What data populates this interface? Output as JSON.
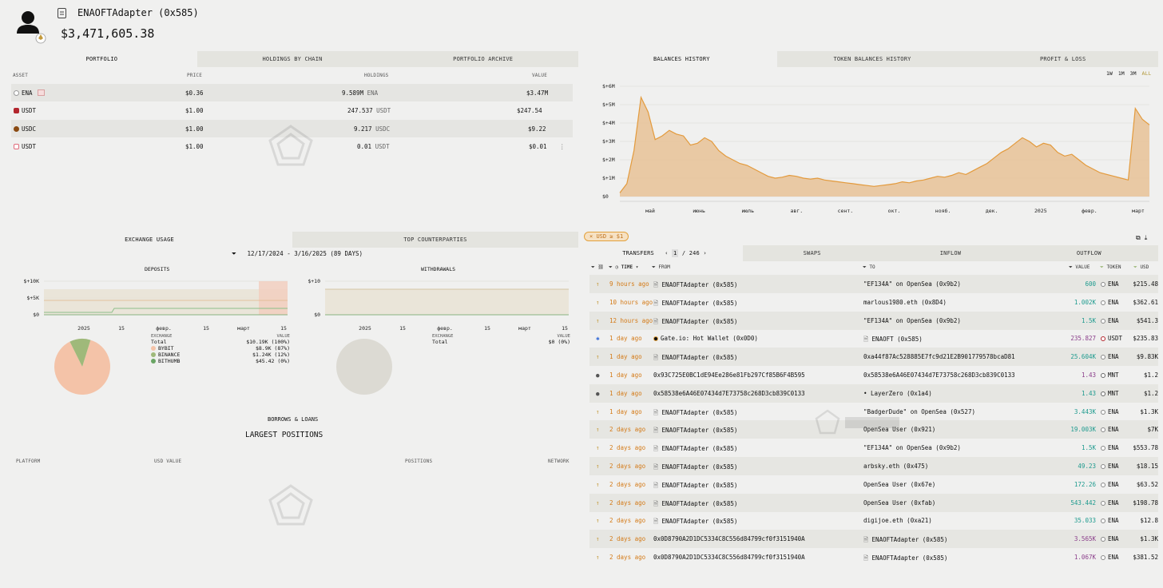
{
  "entity": {
    "name": "ENAOFTAdapter  (0x585)",
    "total": "$3,471,605.38"
  },
  "portfolio": {
    "tabs": [
      "PORTFOLIO",
      "HOLDINGS BY CHAIN",
      "PORTFOLIO ARCHIVE"
    ],
    "headers": {
      "asset": "ASSET",
      "price": "PRICE",
      "holdings": "HOLDINGS",
      "value": "VALUE"
    },
    "rows": [
      {
        "asset": "ENA",
        "price": "$0.36",
        "holdings": "9.589M",
        "unit": "ENA",
        "value": "$3.47M",
        "color": "#9a9a9a"
      },
      {
        "asset": "USDT",
        "price": "$1.00",
        "holdings": "247.537",
        "unit": "USDT",
        "value": "$247.54",
        "color": "#b3262e"
      },
      {
        "asset": "USDC",
        "price": "$1.00",
        "holdings": "9.217",
        "unit": "USDC",
        "value": "$9.22",
        "color": "#8a4a12"
      },
      {
        "asset": "USDT",
        "price": "$1.00",
        "holdings": "0.01",
        "unit": "USDT",
        "value": "$0.01",
        "color": "#e06a7a"
      }
    ]
  },
  "balances": {
    "tabs": [
      "BALANCES HISTORY",
      "TOKEN BALANCES HISTORY",
      "PROFIT & LOSS"
    ],
    "ranges": [
      "1W",
      "1M",
      "3M",
      "ALL"
    ],
    "active_range": "ALL",
    "accent": "#e39a3c"
  },
  "chart_data": [
    {
      "type": "area",
      "y_ticks": [
        "$+6M",
        "$+5M",
        "$+4M",
        "$+3M",
        "$+2M",
        "$+1M",
        "$0"
      ],
      "x_ticks": [
        "май",
        "июнь",
        "июль",
        "авг.",
        "сент.",
        "окт.",
        "нояб.",
        "дек.",
        "2025",
        "февр.",
        "март"
      ],
      "ylim": [
        0,
        6000000
      ],
      "values": [
        0.2,
        0.7,
        2.5,
        5.4,
        4.6,
        3.1,
        3.3,
        3.6,
        3.4,
        3.3,
        2.8,
        2.9,
        3.2,
        3.0,
        2.5,
        2.2,
        2.0,
        1.8,
        1.7,
        1.5,
        1.3,
        1.1,
        1.0,
        1.05,
        1.15,
        1.1,
        1.0,
        0.95,
        1.0,
        0.9,
        0.85,
        0.8,
        0.75,
        0.7,
        0.65,
        0.6,
        0.55,
        0.6,
        0.65,
        0.7,
        0.8,
        0.75,
        0.85,
        0.9,
        1.0,
        1.1,
        1.05,
        1.15,
        1.3,
        1.2,
        1.4,
        1.6,
        1.8,
        2.1,
        2.4,
        2.6,
        2.9,
        3.2,
        3.0,
        2.7,
        2.9,
        2.8,
        2.4,
        2.2,
        2.3,
        2.0,
        1.7,
        1.5,
        1.3,
        1.2,
        1.1,
        1.0,
        0.9,
        4.8,
        4.2,
        3.9
      ]
    },
    {
      "type": "line",
      "title": "DEPOSITS",
      "y_ticks": [
        "$+10K",
        "$+5K",
        "$0"
      ],
      "x_ticks": [
        "2025",
        "15",
        "февр.",
        "15",
        "март",
        "15"
      ],
      "ylim": [
        0,
        10000
      ]
    },
    {
      "type": "line",
      "title": "WITHDRAWALS",
      "y_ticks": [
        "$+10",
        "$0"
      ],
      "x_ticks": [
        "2025",
        "15",
        "февр.",
        "15",
        "март",
        "15"
      ],
      "ylim": [
        0,
        10
      ]
    },
    {
      "type": "pie",
      "title": "DEPOSITS",
      "categories": [
        "BYBIT",
        "BINANCE",
        "BITHUMB"
      ],
      "values": [
        87,
        12,
        0
      ],
      "colors": [
        "#f4c3a8",
        "#9fb97a",
        "#6aa564"
      ]
    }
  ],
  "exchange": {
    "tabs": [
      "EXCHANGE USAGE",
      "TOP COUNTERPARTIES"
    ],
    "date_range": "12/17/2024 - 3/16/2025  (89 DAYS)",
    "deposits_title": "DEPOSITS",
    "withdrawals_title": "WITHDRAWALS",
    "legend_header": {
      "exchange": "EXCHANGE",
      "value": "VALUE"
    },
    "deposit_total": {
      "label": "Total",
      "value": "$10.19K (100%)"
    },
    "deposit_items": [
      {
        "name": "BYBIT",
        "value": "$8.9K (87%)",
        "color": "#f4c3a8"
      },
      {
        "name": "BINANCE",
        "value": "$1.24K (12%)",
        "color": "#9fb97a"
      },
      {
        "name": "BITHUMB",
        "value": "$45.42 (0%)",
        "color": "#6aa564"
      }
    ],
    "withdraw_total": {
      "label": "Total",
      "value": "$0 (0%)"
    }
  },
  "loans": {
    "title": "BORROWS & LOANS",
    "subtitle": "LARGEST POSITIONS",
    "headers": {
      "platform": "PLATFORM",
      "usd": "USD VALUE",
      "positions": "POSITIONS",
      "network": "NETWORK"
    }
  },
  "transfers": {
    "filter_chip": "USD ≥ $1",
    "tabs": [
      "TRANSFERS",
      "SWAPS",
      "INFLOW",
      "OUTFLOW"
    ],
    "page_current": "1",
    "page_total": "/ 246",
    "headers": {
      "time": "TIME",
      "from": "FROM",
      "to": "TO",
      "value": "VALUE",
      "token": "TOKEN",
      "usd": "USD"
    },
    "rows": [
      {
        "time": "9 hours ago",
        "from": "ENAOFTAdapter (0x585)",
        "to": "\"EF134A\" on OpenSea (0x9b2)",
        "value": "600",
        "token": "ENA",
        "usd": "$215.48",
        "vc": "teal",
        "ic": "#c49a3c",
        "icon": "↑"
      },
      {
        "time": "10 hours ago",
        "from": "ENAOFTAdapter (0x585)",
        "to": "marlous1980.eth (0x8D4)",
        "value": "1.002K",
        "token": "ENA",
        "usd": "$362.61",
        "vc": "teal",
        "ic": "#c49a3c",
        "icon": "↑"
      },
      {
        "time": "12 hours ago",
        "from": "ENAOFTAdapter (0x585)",
        "to": "\"EF134A\" on OpenSea (0x9b2)",
        "value": "1.5K",
        "token": "ENA",
        "usd": "$541.3",
        "vc": "teal",
        "ic": "#c49a3c",
        "icon": "↑"
      },
      {
        "time": "1 day ago",
        "from": "Gate.io: Hot Wallet (0x0D0)",
        "to": "ENAOFT (0x585)",
        "value": "235.827",
        "token": "USDT",
        "usd": "$235.83",
        "vc": "purple",
        "ic": "#3b6fd8",
        "icon": "✱"
      },
      {
        "time": "1 day ago",
        "from": "ENAOFTAdapter (0x585)",
        "to": "0xa44f87Ac528885E7fc9d21E2B901779578bcaD81",
        "value": "25.604K",
        "token": "ENA",
        "usd": "$9.83K",
        "vc": "teal",
        "ic": "#c49a3c",
        "icon": "↑"
      },
      {
        "time": "1 day ago",
        "from": "0x93C725E0BC1dE94Ee286e81Fb297Cf85B6F4B595",
        "to": "0x58538e6A46E07434d7E73758c268D3cb839C0133",
        "value": "1.43",
        "token": "MNT",
        "usd": "$1.2",
        "vc": "purple",
        "ic": "#555",
        "icon": "●"
      },
      {
        "time": "1 day ago",
        "from": "0x58538e6A46E07434d7E73758c268D3cb839C0133",
        "to": "• LayerZero (0x1a4)",
        "value": "1.43",
        "token": "MNT",
        "usd": "$1.2",
        "vc": "teal",
        "ic": "#555",
        "icon": "●"
      },
      {
        "time": "1 day ago",
        "from": "ENAOFTAdapter (0x585)",
        "to": "\"BadgerDude\" on OpenSea (0x527)",
        "value": "3.443K",
        "token": "ENA",
        "usd": "$1.3K",
        "vc": "teal",
        "ic": "#c49a3c",
        "icon": "↑"
      },
      {
        "time": "2 days ago",
        "from": "ENAOFTAdapter (0x585)",
        "to": "OpenSea User (0x921)",
        "value": "19.003K",
        "token": "ENA",
        "usd": "$7K",
        "vc": "teal",
        "ic": "#c49a3c",
        "icon": "↑"
      },
      {
        "time": "2 days ago",
        "from": "ENAOFTAdapter (0x585)",
        "to": "\"EF134A\" on OpenSea (0x9b2)",
        "value": "1.5K",
        "token": "ENA",
        "usd": "$553.78",
        "vc": "teal",
        "ic": "#c49a3c",
        "icon": "↑"
      },
      {
        "time": "2 days ago",
        "from": "ENAOFTAdapter (0x585)",
        "to": "arbsky.eth (0x475)",
        "value": "49.23",
        "token": "ENA",
        "usd": "$18.15",
        "vc": "teal",
        "ic": "#c49a3c",
        "icon": "↑"
      },
      {
        "time": "2 days ago",
        "from": "ENAOFTAdapter (0x585)",
        "to": "OpenSea User (0x67e)",
        "value": "172.26",
        "token": "ENA",
        "usd": "$63.52",
        "vc": "teal",
        "ic": "#c49a3c",
        "icon": "↑"
      },
      {
        "time": "2 days ago",
        "from": "ENAOFTAdapter (0x585)",
        "to": "OpenSea User (0xfab)",
        "value": "543.442",
        "token": "ENA",
        "usd": "$198.78",
        "vc": "teal",
        "ic": "#c49a3c",
        "icon": "↑"
      },
      {
        "time": "2 days ago",
        "from": "ENAOFTAdapter (0x585)",
        "to": "digijoe.eth (0xa21)",
        "value": "35.033",
        "token": "ENA",
        "usd": "$12.8",
        "vc": "teal",
        "ic": "#c49a3c",
        "icon": "↑"
      },
      {
        "time": "2 days ago",
        "from": "0x0D8790A2D1DC5334C8C556d84799cf0f3151940A",
        "to": "ENAOFTAdapter (0x585)",
        "value": "3.565K",
        "token": "ENA",
        "usd": "$1.3K",
        "vc": "purple",
        "ic": "#c49a3c",
        "icon": "↑"
      },
      {
        "time": "2 days ago",
        "from": "0x0D8790A2D1DC5334C8C556d84799cf0f3151940A",
        "to": "ENAOFTAdapter (0x585)",
        "value": "1.067K",
        "token": "ENA",
        "usd": "$381.52",
        "vc": "purple",
        "ic": "#c49a3c",
        "icon": "↑"
      }
    ]
  }
}
